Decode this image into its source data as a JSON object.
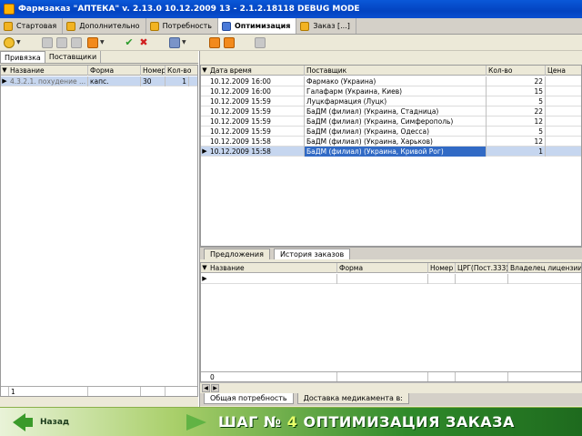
{
  "window": {
    "title": "Фармзаказ \"АПТЕКА\"   v. 2.13.0 10.12.2009 13 - 2.1.2.18118 DEBUG MODE"
  },
  "doc_tabs": [
    {
      "label": "Стартовая"
    },
    {
      "label": "Дополнительно"
    },
    {
      "label": "Потребность"
    },
    {
      "label": "Оптимизация"
    },
    {
      "label": "Заказ [...]"
    }
  ],
  "left_panel": {
    "tabs": [
      {
        "label": "Привязка"
      },
      {
        "label": "Поставщики"
      }
    ],
    "columns": [
      "Название",
      "Форма",
      "Номер",
      "Кол-во"
    ],
    "rows": [
      {
        "name": "4.3.2.1. похудение ...",
        "form": "капс.",
        "number": "30",
        "qty": "1"
      }
    ],
    "footer_value": "1"
  },
  "suppliers_grid": {
    "columns": [
      "Дата время",
      "Поставщик",
      "Кол-во",
      "Цена"
    ],
    "rows": [
      {
        "date": "10.12.2009 16:00",
        "supplier": "Фармако (Украина)",
        "qty": "22",
        "price": ""
      },
      {
        "date": "10.12.2009 16:00",
        "supplier": "Галафарм (Украина, Киев)",
        "qty": "15",
        "price": ""
      },
      {
        "date": "10.12.2009 15:59",
        "supplier": "Луцкфармация (Луцк)",
        "qty": "5",
        "price": ""
      },
      {
        "date": "10.12.2009 15:59",
        "supplier": "БаДМ (филиал) (Украина, Стадница)",
        "qty": "22",
        "price": ""
      },
      {
        "date": "10.12.2009 15:59",
        "supplier": "БаДМ (филиал) (Украина, Симферополь)",
        "qty": "12",
        "price": ""
      },
      {
        "date": "10.12.2009 15:59",
        "supplier": "БаДМ (филиал) (Украина, Одесса)",
        "qty": "5",
        "price": ""
      },
      {
        "date": "10.12.2009 15:58",
        "supplier": "БаДМ (филиал) (Украина, Харьков)",
        "qty": "12",
        "price": ""
      },
      {
        "date": "10.12.2009 15:58",
        "supplier": "БаДМ (филиал) (Украина, Кривой Рог)",
        "qty": "1",
        "price": ""
      }
    ]
  },
  "middle_tabs": [
    {
      "label": "Предложения"
    },
    {
      "label": "История заказов"
    }
  ],
  "history_grid": {
    "columns": [
      "Название",
      "Форма",
      "Номер",
      "ЦРГ(Пост.333)",
      "Владелец лицензии"
    ],
    "footer_value": "0"
  },
  "bottom_tabs": [
    {
      "label": "Общая потребность"
    },
    {
      "label": "Доставка медикамента в:"
    }
  ],
  "footer": {
    "back_label": "Назад",
    "step_prefix": "ШАГ №",
    "step_number": "4",
    "step_title": "ОПТИМИЗАЦИЯ ЗАКАЗА"
  }
}
